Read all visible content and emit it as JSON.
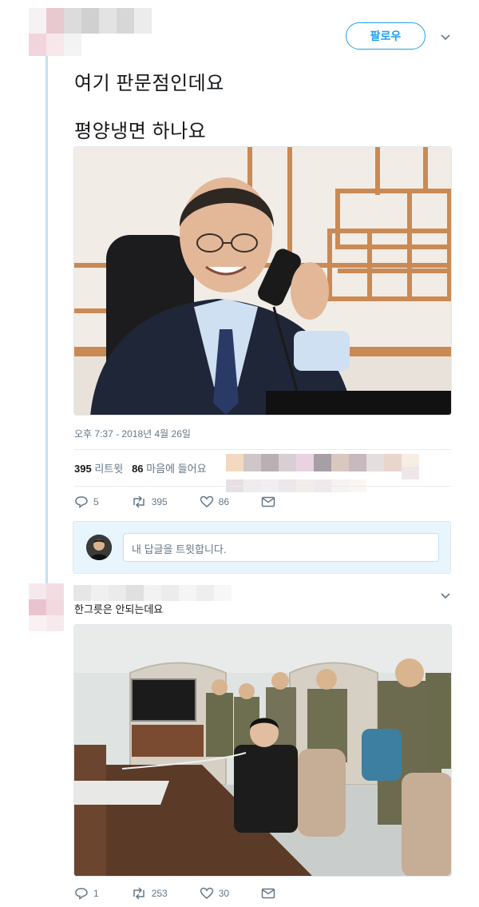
{
  "header": {
    "follow_label": "팔로우"
  },
  "tweet": {
    "line1": "여기 판문점인데요",
    "line2": "평양냉면 하나요",
    "timestamp": "오후 7:37 - 2018년 4월 26일",
    "retweet_count": "395",
    "retweet_label": "리트윗",
    "like_count": "86",
    "like_label": "마음에 들어요",
    "actions": {
      "replies": "5",
      "retweets": "395",
      "likes": "86"
    }
  },
  "reply_box": {
    "placeholder": "내 답글을 트윗합니다."
  },
  "reply": {
    "text": "한그릇은 안되는데요",
    "actions": {
      "replies": "1",
      "retweets": "253",
      "likes": "30"
    }
  },
  "icons": {
    "reply": "reply-icon",
    "retweet": "retweet-icon",
    "like": "heart-icon",
    "dm": "envelope-icon",
    "more": "chevron-down-icon"
  },
  "colors": {
    "accent": "#1da1f2",
    "thread_line": "#c4dff6",
    "muted": "#657786"
  }
}
